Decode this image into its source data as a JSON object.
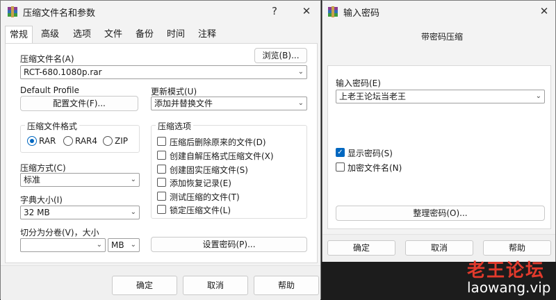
{
  "archive_dialog": {
    "title": "压缩文件名和参数",
    "help_btn": "?",
    "close_btn": "✕",
    "tabs": [
      "常规",
      "高级",
      "选项",
      "文件",
      "备份",
      "时间",
      "注释"
    ],
    "archive_name_label": "压缩文件名(A)",
    "browse_label": "浏览(B)...",
    "archive_name_value": "RCT-680.1080p.rar",
    "default_profile_label": "Default Profile",
    "config_button_label": "配置文件(F)...",
    "update_mode_label": "更新模式(U)",
    "update_mode_value": "添加并替换文件",
    "format_group_label": "压缩文件格式",
    "formats": [
      "RAR",
      "RAR4",
      "ZIP"
    ],
    "selected_format": "RAR",
    "method_label": "压缩方式(C)",
    "method_value": "标准",
    "dict_label": "字典大小(I)",
    "dict_value": "32 MB",
    "split_label": "切分为分卷(V)，大小",
    "split_value": "",
    "split_unit": "MB",
    "options_group_label": "压缩选项",
    "options": [
      {
        "label": "压缩后删除原来的文件(D)",
        "checked": false
      },
      {
        "label": "创建自解压格式压缩文件(X)",
        "checked": false
      },
      {
        "label": "创建固实压缩文件(S)",
        "checked": false
      },
      {
        "label": "添加恢复记录(E)",
        "checked": false
      },
      {
        "label": "测试压缩的文件(T)",
        "checked": false
      },
      {
        "label": "锁定压缩文件(L)",
        "checked": false
      }
    ],
    "set_password_label": "设置密码(P)...",
    "ok_label": "确定",
    "cancel_label": "取消",
    "help_label": "帮助"
  },
  "password_dialog": {
    "title": "输入密码",
    "close_btn": "✕",
    "heading": "带密码压缩",
    "password_label": "输入密码(E)",
    "password_value": "上老王论坛当老王",
    "show_password_label": "显示密码(S)",
    "show_password_checked": true,
    "encrypt_names_label": "加密文件名(N)",
    "encrypt_names_checked": false,
    "organize_label": "整理密码(O)...",
    "ok_label": "确定",
    "cancel_label": "取消",
    "help_label": "帮助"
  },
  "watermark": {
    "line1": "老王论坛",
    "line2": "laowang.vip"
  },
  "colors": {
    "accent": "#0067c0",
    "watermark": "#e23a2c"
  }
}
